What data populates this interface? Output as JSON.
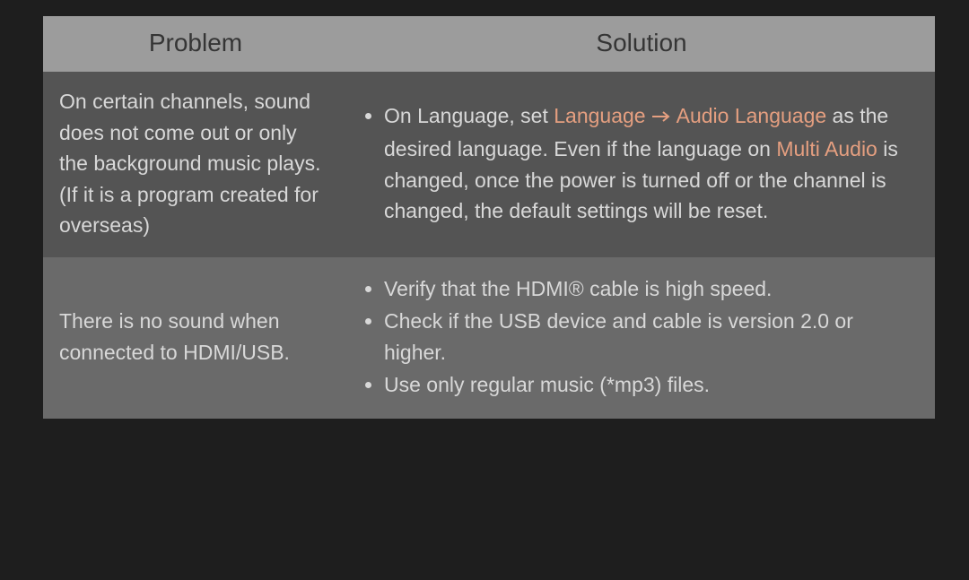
{
  "headers": {
    "problem": "Problem",
    "solution": "Solution"
  },
  "rows": [
    {
      "problem": "On certain channels, sound does not come out or only the background music plays. (If it is a program created for overseas)",
      "solution": {
        "prefix": "On Language, set ",
        "link1": "Language",
        "link2": "Audio Language",
        "mid": " as the desired language. Even if the language on ",
        "link3": "Multi Audio",
        "suffix": " is changed, once the power is turned off or the channel is changed, the default settings will be reset."
      }
    },
    {
      "problem": "There is no sound when connected to HDMI/USB.",
      "solution": {
        "items": [
          "Verify that the HDMI® cable is high speed.",
          "Check if the USB device and cable is version 2.0 or higher.",
          "Use only regular music (*mp3) files."
        ]
      }
    }
  ]
}
